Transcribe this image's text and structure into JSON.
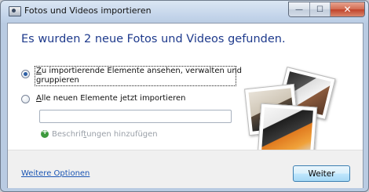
{
  "window": {
    "title": "Fotos und Videos importieren",
    "controls": {
      "minimize": "—",
      "maximize": "☐",
      "close": "✕"
    }
  },
  "dialog": {
    "heading": "Es wurden 2 neue Fotos und Videos gefunden.",
    "options": [
      {
        "mnemonic": "Z",
        "label_rest": "u importierende Elemente ansehen, verwalten und",
        "label_line2": "gruppieren",
        "checked": true
      },
      {
        "mnemonic": "A",
        "label_rest": "lle neuen Elemente jetzt importieren",
        "checked": false
      }
    ],
    "tag_input": {
      "value": "",
      "placeholder": ""
    },
    "add_tags": {
      "before": "Beschrif",
      "mnemonic": "t",
      "after": "ungen hinzufügen",
      "icon": "add-tag-icon"
    }
  },
  "footer": {
    "more_options": "Weitere Optionen",
    "continue": "Weiter"
  },
  "colors": {
    "heading": "#1e3a8c",
    "link": "#1a55b4",
    "button_border": "#3c7fb1"
  }
}
